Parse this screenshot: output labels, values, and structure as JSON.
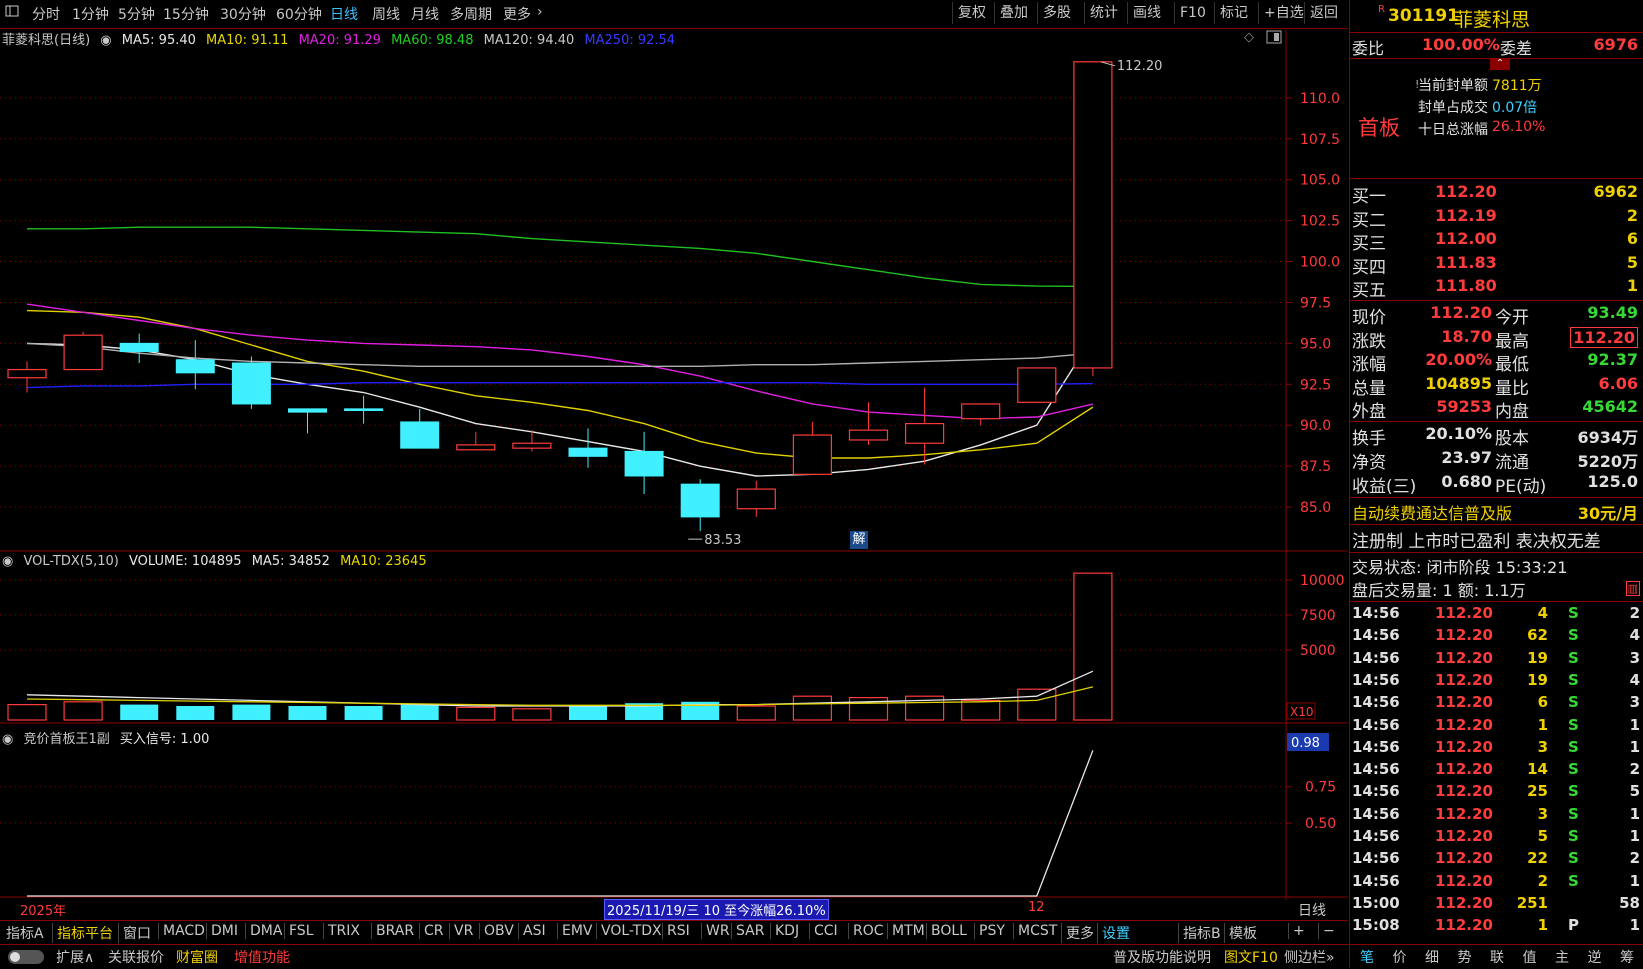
{
  "toolbar": {
    "periods": [
      "分时",
      "1分钟",
      "5分钟",
      "15分钟",
      "30分钟",
      "60分钟",
      "日线",
      "周线",
      "月线",
      "多周期",
      "更多"
    ],
    "active_period": "日线",
    "more_label": "更多",
    "right": [
      "复权",
      "叠加",
      "多股",
      "统计",
      "画线",
      "F10",
      "标记",
      "+自选",
      "返回"
    ]
  },
  "main_legend": {
    "name": "菲菱科思(日线)",
    "ma5": "MA5: 95.40",
    "ma10": "MA10: 91.11",
    "ma20": "MA20: 91.29",
    "ma60": "MA60: 98.48",
    "ma120": "MA120: 94.40",
    "ma250": "MA250: 92.54"
  },
  "vol_legend": {
    "name": "VOL-TDX(5,10)",
    "volume": "VOLUME: 104895",
    "ma5": "MA5: 34852",
    "ma10": "MA10: 23645"
  },
  "ind_legend": {
    "name": "竞价首板王1副",
    "signal": "买入信号: 1.00"
  },
  "chart_labels": {
    "high_label": "112.20",
    "low_label": "83.53",
    "jie_badge": "解",
    "year_label": "2025年",
    "range_label": "2025/11/19/三 10 至今涨幅26.10%",
    "month_label": "12",
    "period_label": "日线",
    "vol_scale_label": "X10",
    "ind_value_label": "0.98"
  },
  "colors": {
    "up": "#ff3b3b",
    "down": "#40f0ff",
    "ma5": "#e8e8e8",
    "ma10": "#e0d000",
    "ma20": "#e020e0",
    "ma60": "#20c020",
    "ma120": "#b0b0b0",
    "ma250": "#2020ff",
    "grid": "#8a0000"
  },
  "chart_data": [
    {
      "type": "candlestick",
      "title": "菲菱科思(日线)",
      "price_ticks": [
        85.0,
        87.5,
        90.0,
        92.5,
        95.0,
        97.5,
        100.0,
        102.5,
        105.0,
        107.5,
        110.0
      ],
      "ylim": [
        82.5,
        112.8
      ],
      "candles": [
        {
          "o": 92.9,
          "c": 93.4,
          "h": 93.9,
          "l": 92.0
        },
        {
          "o": 93.4,
          "c": 95.5,
          "h": 95.7,
          "l": 93.4
        },
        {
          "o": 95.0,
          "c": 94.5,
          "h": 95.6,
          "l": 93.8
        },
        {
          "o": 94.0,
          "c": 93.2,
          "h": 95.2,
          "l": 92.2
        },
        {
          "o": 93.8,
          "c": 91.3,
          "h": 94.2,
          "l": 91.0
        },
        {
          "o": 91.0,
          "c": 90.8,
          "h": 91.0,
          "l": 89.5
        },
        {
          "o": 91.0,
          "c": 90.9,
          "h": 91.8,
          "l": 90.1
        },
        {
          "o": 90.2,
          "c": 88.6,
          "h": 91.0,
          "l": 88.6
        },
        {
          "o": 88.5,
          "c": 88.8,
          "h": 89.6,
          "l": 88.5
        },
        {
          "o": 88.6,
          "c": 88.9,
          "h": 89.7,
          "l": 88.4
        },
        {
          "o": 88.6,
          "c": 88.1,
          "h": 89.8,
          "l": 87.4
        },
        {
          "o": 88.4,
          "c": 86.9,
          "h": 89.6,
          "l": 85.8
        },
        {
          "o": 86.4,
          "c": 84.4,
          "h": 86.7,
          "l": 83.53
        },
        {
          "o": 84.9,
          "c": 86.1,
          "h": 86.6,
          "l": 84.4
        },
        {
          "o": 87.0,
          "c": 89.4,
          "h": 90.2,
          "l": 87.0
        },
        {
          "o": 89.1,
          "c": 89.7,
          "h": 91.4,
          "l": 88.8
        },
        {
          "o": 88.9,
          "c": 90.1,
          "h": 92.3,
          "l": 87.6
        },
        {
          "o": 90.4,
          "c": 91.3,
          "h": 91.3,
          "l": 90.0
        },
        {
          "o": 91.4,
          "c": 93.5,
          "h": 93.5,
          "l": 91.4
        },
        {
          "o": 93.5,
          "c": 112.2,
          "h": 112.2,
          "l": 93.0
        }
      ],
      "ma": {
        "MA5": [
          95.0,
          94.9,
          94.6,
          94.0,
          93.1,
          92.5,
          92.0,
          91.1,
          90.1,
          89.6,
          89.0,
          88.4,
          87.5,
          86.9,
          87.0,
          87.3,
          87.8,
          88.8,
          90.0,
          95.4
        ],
        "MA10": [
          97.0,
          96.9,
          96.6,
          95.9,
          94.9,
          93.9,
          93.3,
          92.5,
          91.8,
          91.4,
          90.9,
          90.1,
          89.0,
          88.3,
          88.0,
          88.0,
          88.2,
          88.5,
          88.9,
          91.11
        ],
        "MA20": [
          97.4,
          96.9,
          96.4,
          95.9,
          95.5,
          95.2,
          95.0,
          94.9,
          94.8,
          94.6,
          94.2,
          93.7,
          93.0,
          92.1,
          91.3,
          90.8,
          90.6,
          90.4,
          90.5,
          91.29
        ],
        "MA60": [
          102.0,
          102.0,
          102.1,
          102.1,
          102.1,
          102.0,
          101.9,
          101.8,
          101.7,
          101.4,
          101.2,
          101.0,
          100.8,
          100.5,
          100.0,
          99.5,
          99.0,
          98.6,
          98.5,
          98.48
        ],
        "MA120": [
          95.0,
          94.8,
          94.4,
          94.1,
          93.9,
          93.8,
          93.7,
          93.6,
          93.6,
          93.6,
          93.6,
          93.6,
          93.6,
          93.7,
          93.7,
          93.8,
          93.9,
          94.0,
          94.1,
          94.4
        ],
        "MA250": [
          92.3,
          92.4,
          92.4,
          92.5,
          92.5,
          92.5,
          92.6,
          92.6,
          92.6,
          92.6,
          92.6,
          92.6,
          92.6,
          92.6,
          92.6,
          92.5,
          92.5,
          92.5,
          92.5,
          92.54
        ]
      }
    },
    {
      "type": "bar",
      "title": "VOL-TDX(5,10)",
      "ticks": [
        5000,
        7500,
        10000
      ],
      "ylim": [
        0,
        10500
      ],
      "volume": [
        1100,
        1300,
        1100,
        1000,
        1100,
        1000,
        1000,
        1100,
        900,
        800,
        1000,
        1200,
        1300,
        1000,
        1700,
        1600,
        1700,
        1400,
        2200,
        10489
      ],
      "ma5": [
        1800,
        1700,
        1600,
        1500,
        1400,
        1300,
        1200,
        1100,
        1000,
        1000,
        1000,
        1000,
        1100,
        1100,
        1200,
        1300,
        1400,
        1500,
        1700,
        3485
      ],
      "ma10": [
        1500,
        1450,
        1400,
        1350,
        1300,
        1250,
        1200,
        1150,
        1100,
        1050,
        1050,
        1050,
        1050,
        1100,
        1150,
        1200,
        1250,
        1300,
        1400,
        2365
      ]
    },
    {
      "type": "line",
      "title": "竞价首板王1副",
      "ticks": [
        0.5,
        0.75
      ],
      "ylim": [
        0,
        1.05
      ],
      "values": [
        0,
        0,
        0,
        0,
        0,
        0,
        0,
        0,
        0,
        0,
        0,
        0,
        0,
        0,
        0,
        0,
        0,
        0,
        0,
        1.0
      ]
    }
  ],
  "right_panel": {
    "code": "301191",
    "name": "菲菱科思",
    "r_badge": "R",
    "weibi_label": "委比",
    "weibi_value": "100.00%",
    "weicha_label": "委差",
    "weicha_value": "6976",
    "shouban": "首板",
    "feng_rows": [
      {
        "label": "当前封单额",
        "value": "7811万"
      },
      {
        "label": "封单占成交",
        "value": "0.07倍"
      },
      {
        "label": "十日总涨幅",
        "value": "26.10%"
      }
    ],
    "bids": [
      {
        "label": "买一",
        "price": "112.20",
        "vol": "6962"
      },
      {
        "label": "买二",
        "price": "112.19",
        "vol": "2"
      },
      {
        "label": "买三",
        "price": "112.00",
        "vol": "6"
      },
      {
        "label": "买四",
        "price": "111.83",
        "vol": "5"
      },
      {
        "label": "买五",
        "price": "111.80",
        "vol": "1"
      }
    ],
    "quote": [
      {
        "l1": "现价",
        "v1": "112.20",
        "l2": "今开",
        "v2": "93.49",
        "c1": "red",
        "c2": "grn"
      },
      {
        "l1": "涨跌",
        "v1": "18.70",
        "l2": "最高",
        "v2": "112.20",
        "c1": "red",
        "c2": "red"
      },
      {
        "l1": "涨幅",
        "v1": "20.00%",
        "l2": "最低",
        "v2": "92.37",
        "c1": "red",
        "c2": "grn"
      },
      {
        "l1": "总量",
        "v1": "104895",
        "l2": "量比",
        "v2": "6.06",
        "c1": "yel",
        "c2": "red"
      },
      {
        "l1": "外盘",
        "v1": "59253",
        "l2": "内盘",
        "v2": "45642",
        "c1": "red",
        "c2": "grn"
      }
    ],
    "fund": [
      {
        "l1": "换手",
        "v1": "20.10%",
        "l2": "股本",
        "v2": "6934万"
      },
      {
        "l1": "净资",
        "v1": "23.97",
        "l2": "流通",
        "v2": "5220万"
      },
      {
        "l1": "收益(三)",
        "v1": "0.680",
        "l2": "PE(动)",
        "v2": "125.0"
      }
    ],
    "promo": "自动续费通达信普及版",
    "promo_price": "30元/月",
    "notice": "注册制 上市时已盈利 表决权无差",
    "trade_status": "交易状态: 闭市阶段 15:33:21",
    "after_hours": "盘后交易量: 1  额: 1.1万",
    "ticks": [
      {
        "t": "14:56",
        "p": "112.20",
        "v": "4",
        "s": "S",
        "n": "2"
      },
      {
        "t": "14:56",
        "p": "112.20",
        "v": "62",
        "s": "S",
        "n": "4"
      },
      {
        "t": "14:56",
        "p": "112.20",
        "v": "19",
        "s": "S",
        "n": "3"
      },
      {
        "t": "14:56",
        "p": "112.20",
        "v": "19",
        "s": "S",
        "n": "4"
      },
      {
        "t": "14:56",
        "p": "112.20",
        "v": "6",
        "s": "S",
        "n": "3"
      },
      {
        "t": "14:56",
        "p": "112.20",
        "v": "1",
        "s": "S",
        "n": "1"
      },
      {
        "t": "14:56",
        "p": "112.20",
        "v": "3",
        "s": "S",
        "n": "1"
      },
      {
        "t": "14:56",
        "p": "112.20",
        "v": "14",
        "s": "S",
        "n": "2"
      },
      {
        "t": "14:56",
        "p": "112.20",
        "v": "25",
        "s": "S",
        "n": "5"
      },
      {
        "t": "14:56",
        "p": "112.20",
        "v": "3",
        "s": "S",
        "n": "1"
      },
      {
        "t": "14:56",
        "p": "112.20",
        "v": "5",
        "s": "S",
        "n": "1"
      },
      {
        "t": "14:56",
        "p": "112.20",
        "v": "22",
        "s": "S",
        "n": "2"
      },
      {
        "t": "14:56",
        "p": "112.20",
        "v": "2",
        "s": "S",
        "n": "1"
      },
      {
        "t": "15:00",
        "p": "112.20",
        "v": "251",
        "s": "",
        "n": "58"
      },
      {
        "t": "15:08",
        "p": "112.20",
        "v": "1",
        "s": "P",
        "n": "1"
      }
    ],
    "bottom_tabs": [
      "笔",
      "价",
      "细",
      "势",
      "联",
      "值",
      "主",
      "逆",
      "筹"
    ]
  },
  "bottom_bar": {
    "row1": [
      "指标A",
      "指标平台",
      "窗口",
      "MACD",
      "DMI",
      "DMA",
      "FSL",
      "TRIX",
      "BRAR",
      "CR",
      "VR",
      "OBV",
      "ASI",
      "EMV",
      "VOL-TDX",
      "RSI",
      "WR",
      "SAR",
      "KDJ",
      "CCI",
      "ROC",
      "MTM",
      "BOLL",
      "PSY",
      "MCST",
      "更多",
      "设置",
      "指标B",
      "模板",
      "+",
      "−"
    ],
    "row2_left": [
      "扩展∧",
      "关联报价",
      "财富圈",
      "增值功能"
    ],
    "row2_right": [
      "普及版功能说明",
      "图文F10",
      "侧边栏»"
    ]
  }
}
